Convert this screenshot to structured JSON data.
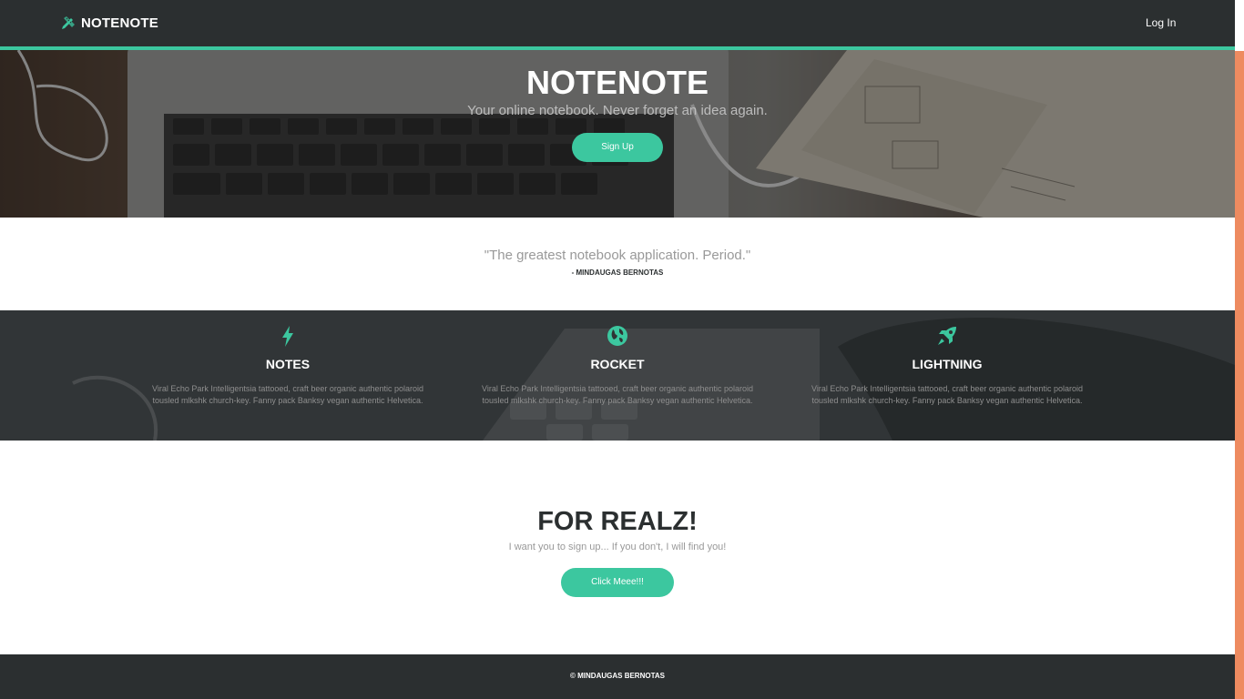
{
  "colors": {
    "accent": "#3cc79f",
    "dark": "#2b2f30",
    "scrollbar": "#ee8b60"
  },
  "navbar": {
    "brand": "NOTENOTE",
    "brand_icon": "pencil-ruler-icon",
    "login": "Log In"
  },
  "hero": {
    "title": "NOTENOTE",
    "subtitle": "Your online notebook. Never forget an idea again.",
    "signup_button": "Sign Up"
  },
  "quote": {
    "text": "\"The greatest notebook application. Period.\"",
    "author": "- MINDAUGAS BERNOTAS"
  },
  "features": [
    {
      "icon": "lightning-bolt-icon",
      "title": "NOTES",
      "description": "Viral Echo Park Intelligentsia tattooed, craft beer organic authentic polaroid tousled mlkshk church-key. Fanny pack Banksy vegan authentic Helvetica."
    },
    {
      "icon": "globe-icon",
      "title": "ROCKET",
      "description": "Viral Echo Park Intelligentsia tattooed, craft beer organic authentic polaroid tousled mlkshk church-key. Fanny pack Banksy vegan authentic Helvetica."
    },
    {
      "icon": "rocket-icon",
      "title": "LIGHTNING",
      "description": "Viral Echo Park Intelligentsia tattooed, craft beer organic authentic polaroid tousled mlkshk church-key. Fanny pack Banksy vegan authentic Helvetica."
    }
  ],
  "cta": {
    "title": "FOR REALZ!",
    "subtitle": "I want you to sign up... If you don't, I will find you!",
    "button": "Click Meee!!!"
  },
  "footer": {
    "text": "© MINDAUGAS BERNOTAS"
  }
}
